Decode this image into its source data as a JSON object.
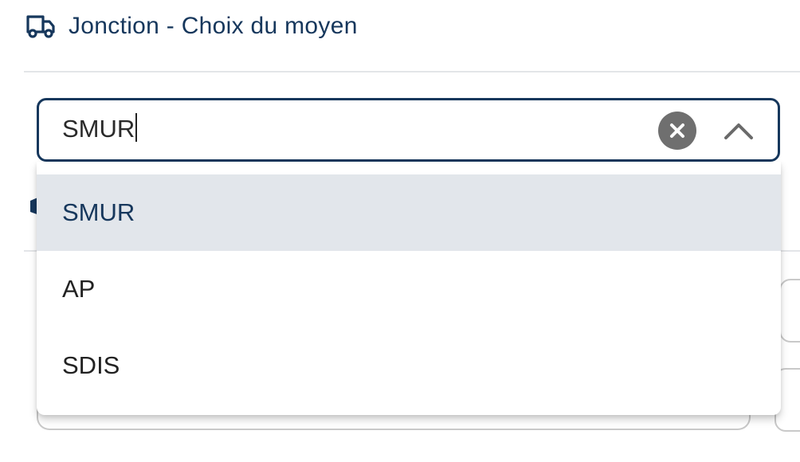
{
  "header": {
    "title": "Jonction - Choix du moyen",
    "icon": "truck-icon"
  },
  "search": {
    "value": "SMUR"
  },
  "dropdown": {
    "options": [
      {
        "label": "SMUR",
        "selected": true
      },
      {
        "label": "AP",
        "selected": false
      },
      {
        "label": "SDIS",
        "selected": false
      }
    ]
  },
  "icons": {
    "clear": "close-icon",
    "toggle": "chevron-up-icon"
  },
  "colors": {
    "accent": "#16375c",
    "selected_option_bg": "#e2e6eb",
    "clear_button_bg": "#6f6f6f",
    "divider": "#e3e5e8"
  }
}
